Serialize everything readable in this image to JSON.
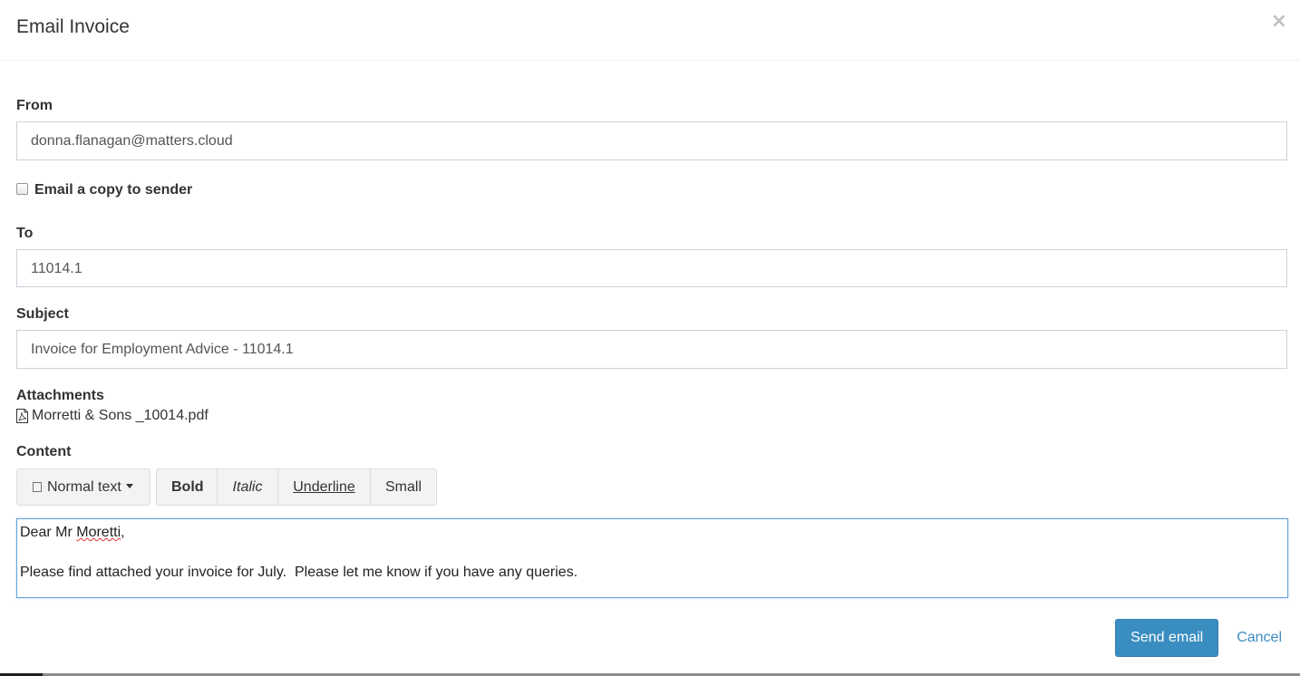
{
  "modal": {
    "title": "Email Invoice",
    "close_label": "×"
  },
  "form": {
    "from": {
      "label": "From",
      "value": "donna.flanagan@matters.cloud"
    },
    "copy_to_sender": {
      "label": "Email a copy to sender",
      "checked": false
    },
    "to": {
      "label": "To",
      "value": "11014.1"
    },
    "subject": {
      "label": "Subject",
      "value": "Invoice for Employment Advice - 11014.1"
    },
    "attachments": {
      "label": "Attachments",
      "items": [
        {
          "icon": "pdf-file-icon",
          "name": "Morretti & Sons _10014.pdf"
        }
      ]
    },
    "content": {
      "label": "Content",
      "toolbar": {
        "style_dropdown": "Normal text",
        "bold": "Bold",
        "italic": "Italic",
        "underline": "Underline",
        "small": "Small"
      },
      "body": {
        "greeting_prefix": "Dear Mr ",
        "greeting_name": "Moretti",
        "greeting_suffix": ",",
        "paragraph": "Please find attached your invoice for July.  Please let me know if you have any queries."
      }
    }
  },
  "actions": {
    "send": "Send email",
    "cancel": "Cancel"
  },
  "colors": {
    "primary": "#3a8dc0",
    "focus_border": "#66a3d6",
    "input_border": "#ccd1d9"
  }
}
